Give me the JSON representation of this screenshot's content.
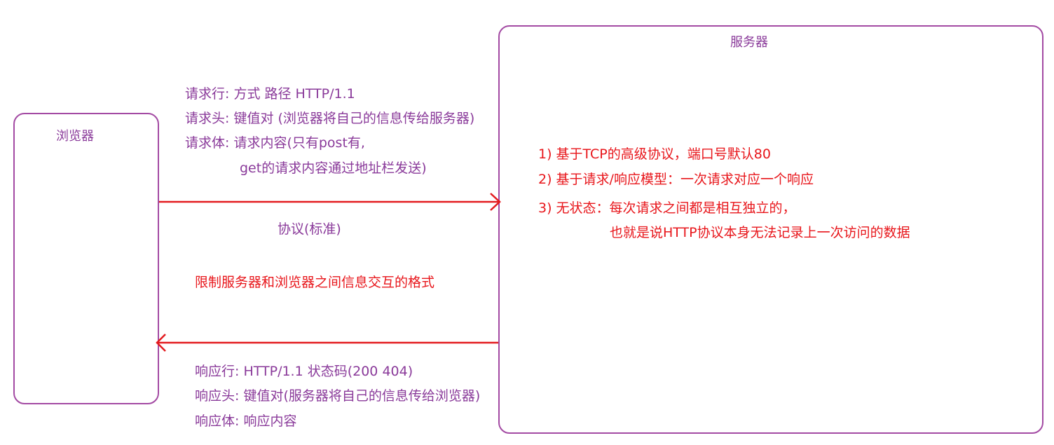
{
  "browser": {
    "label": "浏览器"
  },
  "server": {
    "label": "服务器",
    "features": [
      "1) 基于TCP的高级协议，端口号默认80",
      "2) 基于请求/响应模型：一次请求对应一个响应",
      "3) 无状态：每次请求之间都是相互独立的，",
      "也就是说HTTP协议本身无法记录上一次访问的数据"
    ]
  },
  "request": {
    "line": "请求行: 方式    路径    HTTP/1.1",
    "header": "请求头: 键值对 (浏览器将自己的信息传给服务器)",
    "body": "请求体: 请求内容(只有post有,",
    "body_cont": "get的请求内容通过地址栏发送)"
  },
  "protocol": {
    "title": "协议(标准)",
    "description": "限制服务器和浏览器之间信息交互的格式"
  },
  "response": {
    "line": "响应行: HTTP/1.1  状态码(200 404)",
    "header": "响应头: 键值对(服务器将自己的信息传给浏览器)",
    "body": "响应体: 响应内容"
  },
  "colors": {
    "box_border": "#a34aa3",
    "purple_text": "#8a3a9a",
    "red_text": "#e8161b",
    "arrow": "#e31b1f"
  }
}
